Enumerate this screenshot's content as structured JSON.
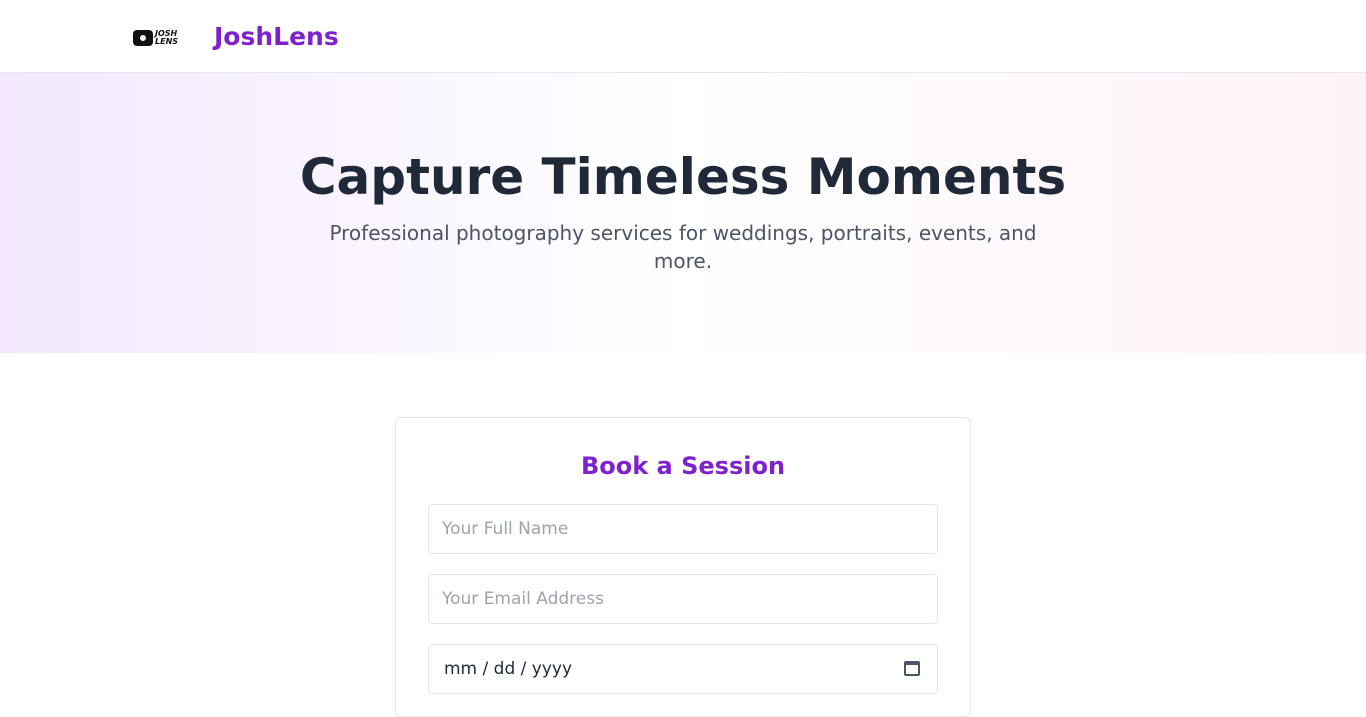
{
  "header": {
    "logo_text": "JOSH LENS",
    "brand": "JoshLens"
  },
  "hero": {
    "title": "Capture Timeless Moments",
    "subtitle": "Professional photography services for weddings, portraits, events, and more."
  },
  "booking": {
    "title": "Book a Session",
    "name_placeholder": "Your Full Name",
    "email_placeholder": "Your Email Address",
    "date_placeholder": "mm / dd / yyyy",
    "date_icon": "calendar-icon"
  },
  "colors": {
    "accent": "#7e22ce",
    "heading": "#1f2937"
  }
}
